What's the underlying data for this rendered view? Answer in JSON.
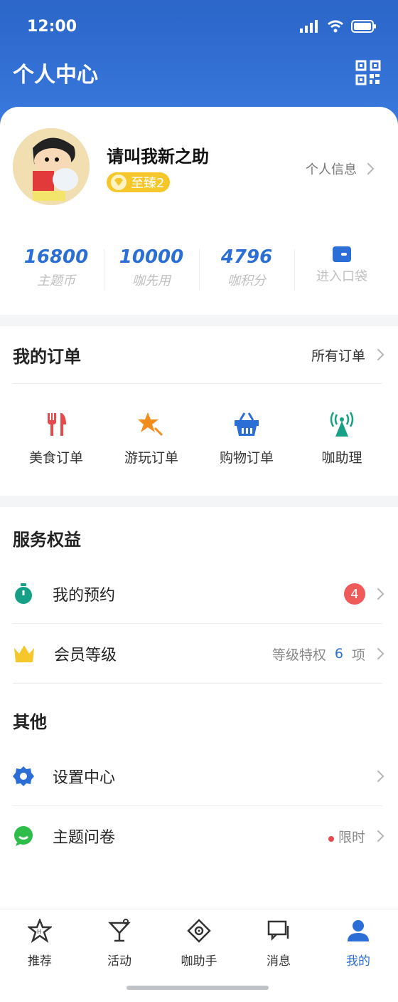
{
  "status_bar": {
    "time": "12:00"
  },
  "header": {
    "title": "个人中心",
    "qr_icon": "qr-code-icon"
  },
  "profile": {
    "name": "请叫我新之助",
    "badge": "至臻2",
    "link_label": "个人信息"
  },
  "stats": [
    {
      "value": "16800",
      "label": "主题币"
    },
    {
      "value": "10000",
      "label": "咖先用"
    },
    {
      "value": "4796",
      "label": "咖积分"
    }
  ],
  "wallet": {
    "label": "进入口袋",
    "icon": "wallet-icon"
  },
  "orders": {
    "title": "我的订单",
    "all_link": "所有订单",
    "items": [
      {
        "label": "美食订单",
        "icon": "fork-knife-icon",
        "color": "#e74a4a"
      },
      {
        "label": "游玩订单",
        "icon": "star-wand-icon",
        "color": "#f28c1a"
      },
      {
        "label": "购物订单",
        "icon": "basket-icon",
        "color": "#2b6fd6"
      },
      {
        "label": "咖助理",
        "icon": "signal-tower-icon",
        "color": "#16a085"
      }
    ]
  },
  "services": {
    "title": "服务权益",
    "rows": [
      {
        "label": "我的预约",
        "icon": "stopwatch-icon",
        "badge": "4"
      },
      {
        "label": "会员等级",
        "icon": "crown-icon",
        "prefix": "等级特权",
        "count": "6",
        "suffix": "项"
      }
    ]
  },
  "others": {
    "title": "其他",
    "rows": [
      {
        "label": "设置中心",
        "icon": "gear-icon"
      },
      {
        "label": "主题问卷",
        "icon": "chat-bubble-icon",
        "tag": "限时"
      }
    ]
  },
  "tabbar": {
    "tabs": [
      {
        "label": "推荐",
        "icon": "star-h-icon"
      },
      {
        "label": "活动",
        "icon": "cocktail-icon"
      },
      {
        "label": "咖助手",
        "icon": "compass-icon"
      },
      {
        "label": "消息",
        "icon": "message-icon"
      },
      {
        "label": "我的",
        "icon": "user-icon",
        "active": true
      }
    ]
  },
  "colors": {
    "primary": "#2b6fd6",
    "header": "#2b66c8",
    "alert": "#ef5b5b",
    "gold": "#f5c72a"
  }
}
